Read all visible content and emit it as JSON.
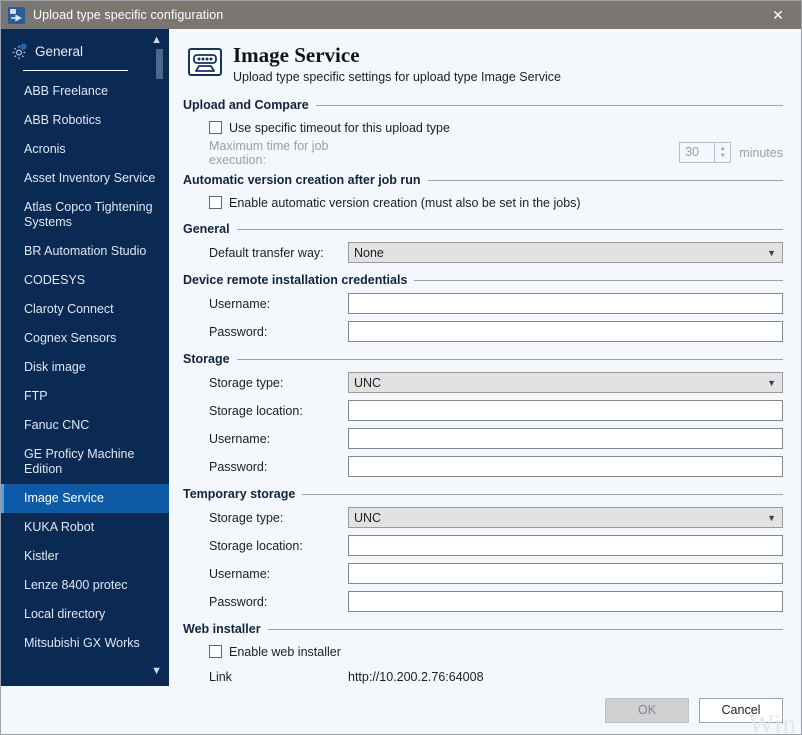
{
  "window": {
    "title": "Upload type specific configuration",
    "close_label": "✕",
    "icon": "app-config-icon"
  },
  "sidebar": {
    "header_label": "General",
    "header_icon": "gear-icon",
    "scroll_up_icon": "chevron-up-icon",
    "scroll_down_icon": "chevron-down-icon",
    "selected": "Image Service",
    "items": [
      {
        "label": "ABB Freelance"
      },
      {
        "label": "ABB Robotics"
      },
      {
        "label": "Acronis"
      },
      {
        "label": "Asset Inventory Service"
      },
      {
        "label": "Atlas Copco Tightening Systems"
      },
      {
        "label": "BR Automation Studio"
      },
      {
        "label": "CODESYS"
      },
      {
        "label": "Claroty Connect"
      },
      {
        "label": "Cognex Sensors"
      },
      {
        "label": "Disk image"
      },
      {
        "label": "FTP"
      },
      {
        "label": "Fanuc CNC"
      },
      {
        "label": "GE Proficy Machine Edition"
      },
      {
        "label": "Image Service"
      },
      {
        "label": "KUKA Robot"
      },
      {
        "label": "Kistler"
      },
      {
        "label": "Lenze 8400 protec"
      },
      {
        "label": "Local directory"
      },
      {
        "label": "Mitsubishi GX Works"
      }
    ]
  },
  "page": {
    "title": "Image Service",
    "subtitle": "Upload type specific settings for upload type Image Service",
    "icon": "image-service-icon"
  },
  "sections": {
    "upload_and_compare": {
      "title": "Upload and Compare",
      "checkbox_label": "Use specific timeout for this upload type",
      "checkbox_checked": false,
      "max_time_label": "Maximum time for job execution:",
      "max_time_value": "30",
      "max_time_unit": "minutes"
    },
    "automatic_version": {
      "title": "Automatic version creation after job run",
      "checkbox_label": "Enable automatic version creation (must also be set in the jobs)",
      "checkbox_checked": false
    },
    "general": {
      "title": "General",
      "transfer_way_label": "Default transfer way:",
      "transfer_way_value": "None"
    },
    "device_credentials": {
      "title": "Device remote installation credentials",
      "username_label": "Username:",
      "username_value": "",
      "password_label": "Password:",
      "password_value": ""
    },
    "storage": {
      "title": "Storage",
      "storage_type_label": "Storage type:",
      "storage_type_value": "UNC",
      "storage_location_label": "Storage location:",
      "storage_location_value": "",
      "username_label": "Username:",
      "username_value": "",
      "password_label": "Password:",
      "password_value": ""
    },
    "temporary_storage": {
      "title": "Temporary storage",
      "storage_type_label": "Storage type:",
      "storage_type_value": "UNC",
      "storage_location_label": "Storage location:",
      "storage_location_value": "",
      "username_label": "Username:",
      "username_value": "",
      "password_label": "Password:",
      "password_value": ""
    },
    "web_installer": {
      "title": "Web installer",
      "checkbox_label": "Enable web installer",
      "checkbox_checked": false,
      "link_label": "Link",
      "link_value": "http://10.200.2.76:64008"
    }
  },
  "footer": {
    "ok_label": "OK",
    "ok_disabled": true,
    "cancel_label": "Cancel",
    "watermark": "Win"
  },
  "colors": {
    "titlebar": "#7a7672",
    "sidebar": "#0a2a54",
    "selection": "#0d5ba6",
    "selection_border": "#4da3e8",
    "panel": "#f4f7fb",
    "section_title": "#10243f"
  }
}
